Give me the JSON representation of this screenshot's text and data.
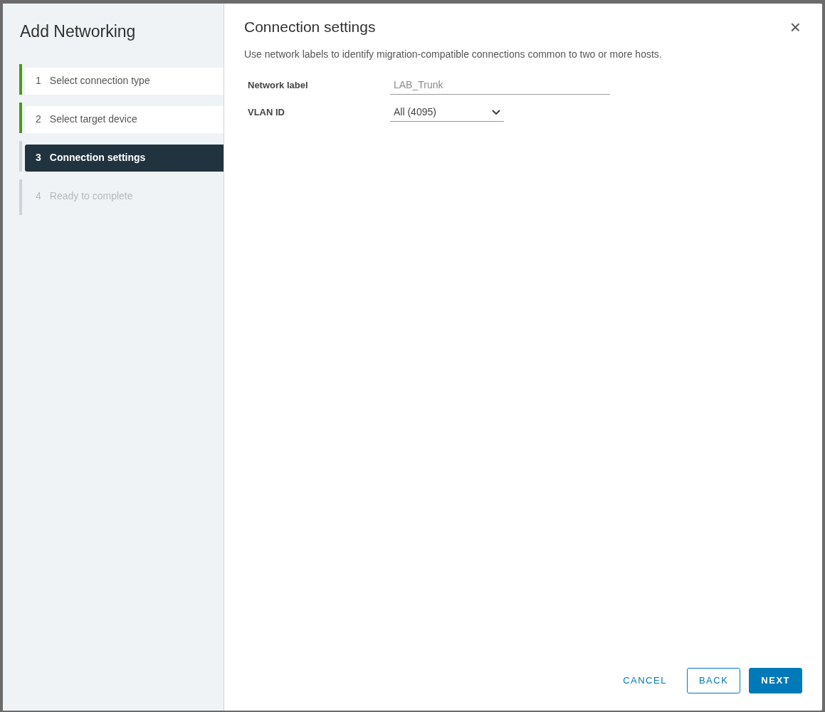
{
  "wizard": {
    "title": "Add Networking",
    "steps": [
      {
        "number": "1",
        "label": "Select connection type",
        "selected": false,
        "completed": true,
        "disabled": false
      },
      {
        "number": "2",
        "label": "Select target device",
        "selected": false,
        "completed": true,
        "disabled": false
      },
      {
        "number": "3",
        "label": "Connection settings",
        "selected": true,
        "completed": false,
        "disabled": false
      },
      {
        "number": "4",
        "label": "Ready to complete",
        "selected": false,
        "completed": false,
        "disabled": true
      }
    ]
  },
  "page": {
    "title": "Connection settings",
    "close": "×",
    "description": "Use network labels to identify migration-compatible connections common to two or more hosts.",
    "fields": [
      {
        "kind": "text",
        "label": "Network label",
        "placeholder": "LAB_Trunk"
      },
      {
        "kind": "select",
        "label": "VLAN ID",
        "value": "All (4095)"
      }
    ]
  },
  "buttons": [
    {
      "kind": "link",
      "label": "CANCEL"
    },
    {
      "kind": "outline",
      "label": "BACK"
    },
    {
      "kind": "primary",
      "label": "NEXT"
    }
  ]
}
